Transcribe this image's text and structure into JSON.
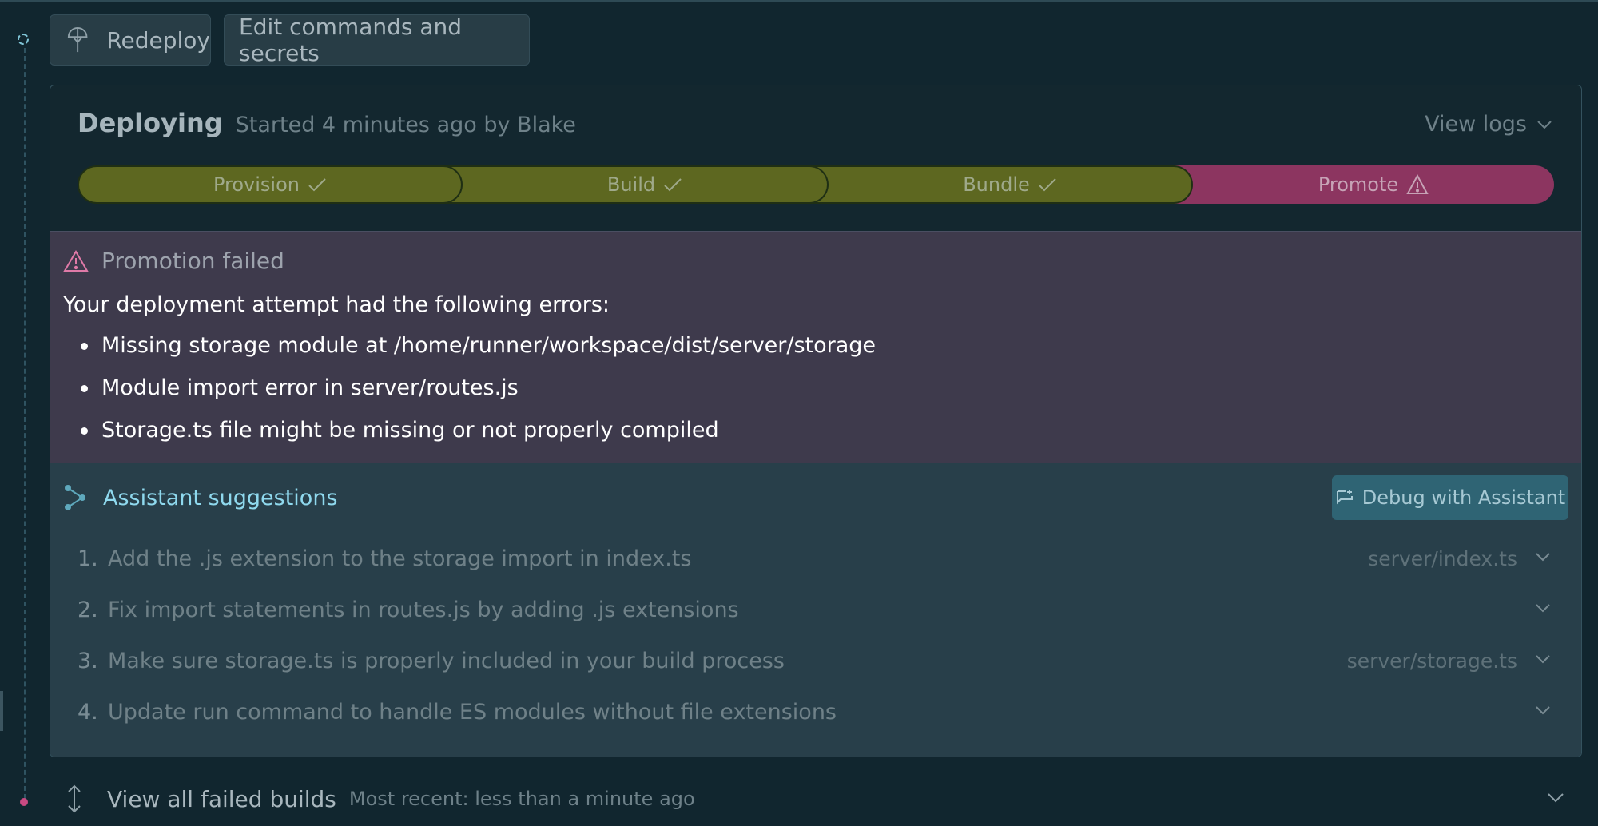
{
  "toolbar": {
    "redeploy_label": "Redeploy",
    "edit_label": "Edit commands and secrets"
  },
  "deployment": {
    "status": "Deploying",
    "started": "Started 4 minutes ago by Blake",
    "view_logs_label": "View logs",
    "stages": [
      {
        "label": "Provision",
        "state": "success"
      },
      {
        "label": "Build",
        "state": "success"
      },
      {
        "label": "Bundle",
        "state": "success"
      },
      {
        "label": "Promote",
        "state": "warning"
      }
    ]
  },
  "error": {
    "title": "Promotion failed",
    "intro": "Your deployment attempt had the following errors:",
    "items": [
      "Missing storage module at /home/runner/workspace/dist/server/storage",
      "Module import error in server/routes.js",
      "Storage.ts file might be missing or not properly compiled"
    ]
  },
  "assistant": {
    "title": "Assistant suggestions",
    "debug_label": "Debug with Assistant",
    "suggestions": [
      {
        "num": "1.",
        "text": "Add the .js extension to the storage import in index.ts",
        "file": "server/index.ts"
      },
      {
        "num": "2.",
        "text": "Fix import statements in routes.js by adding .js extensions",
        "file": ""
      },
      {
        "num": "3.",
        "text": "Make sure storage.ts is properly included in your build process",
        "file": "server/storage.ts"
      },
      {
        "num": "4.",
        "text": "Update run command to handle ES modules without file extensions",
        "file": ""
      }
    ]
  },
  "failed_builds": {
    "title": "View all failed builds",
    "subtitle": "Most recent: less than a minute ago"
  },
  "colors": {
    "background": "#11262f",
    "stage_success": "#5d6720",
    "stage_warning": "#8c3560",
    "error_bg": "#3e3a4c",
    "assistant_accent": "#8fd9ee"
  }
}
